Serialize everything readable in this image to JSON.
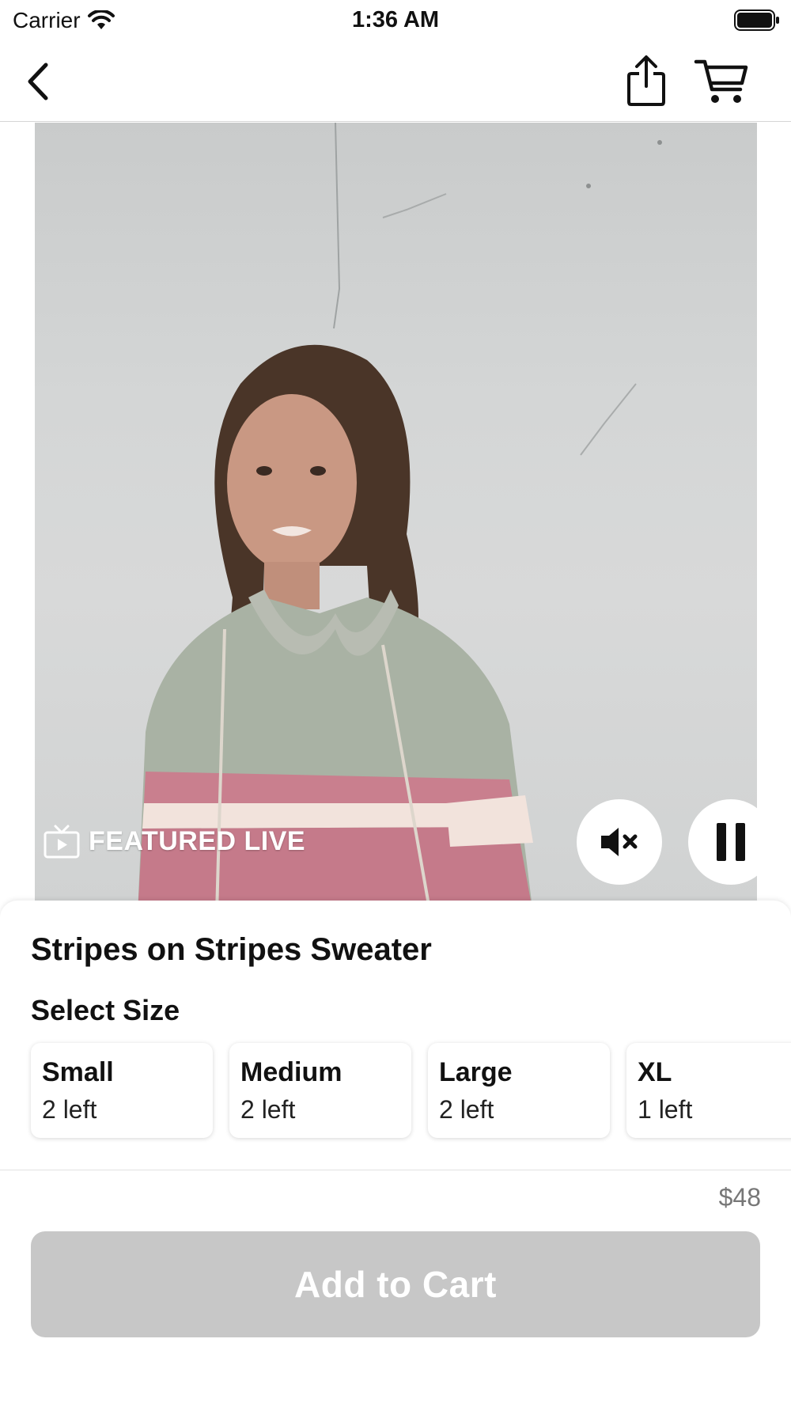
{
  "status_bar": {
    "carrier": "Carrier",
    "time": "1:36 AM"
  },
  "nav": {
    "back_icon": "chevron-left-icon",
    "share_icon": "share-icon",
    "cart_icon": "cart-icon"
  },
  "video": {
    "badge_label": "FEATURED LIVE",
    "badge_icon": "tv-icon",
    "mute_icon": "speaker-muted-icon",
    "pause_icon": "pause-icon"
  },
  "product": {
    "title": "Stripes on Stripes Sweater",
    "select_size_label": "Select Size",
    "sizes": [
      {
        "name": "Small",
        "stock": "2 left"
      },
      {
        "name": "Medium",
        "stock": "2 left"
      },
      {
        "name": "Large",
        "stock": "2 left"
      },
      {
        "name": "XL",
        "stock": "1 left"
      }
    ]
  },
  "checkout": {
    "price": "$48",
    "add_to_cart_label": "Add to Cart"
  },
  "colors": {
    "button_disabled": "#c7c7c7",
    "price_text": "#777777",
    "divider": "#d6d6d6"
  }
}
